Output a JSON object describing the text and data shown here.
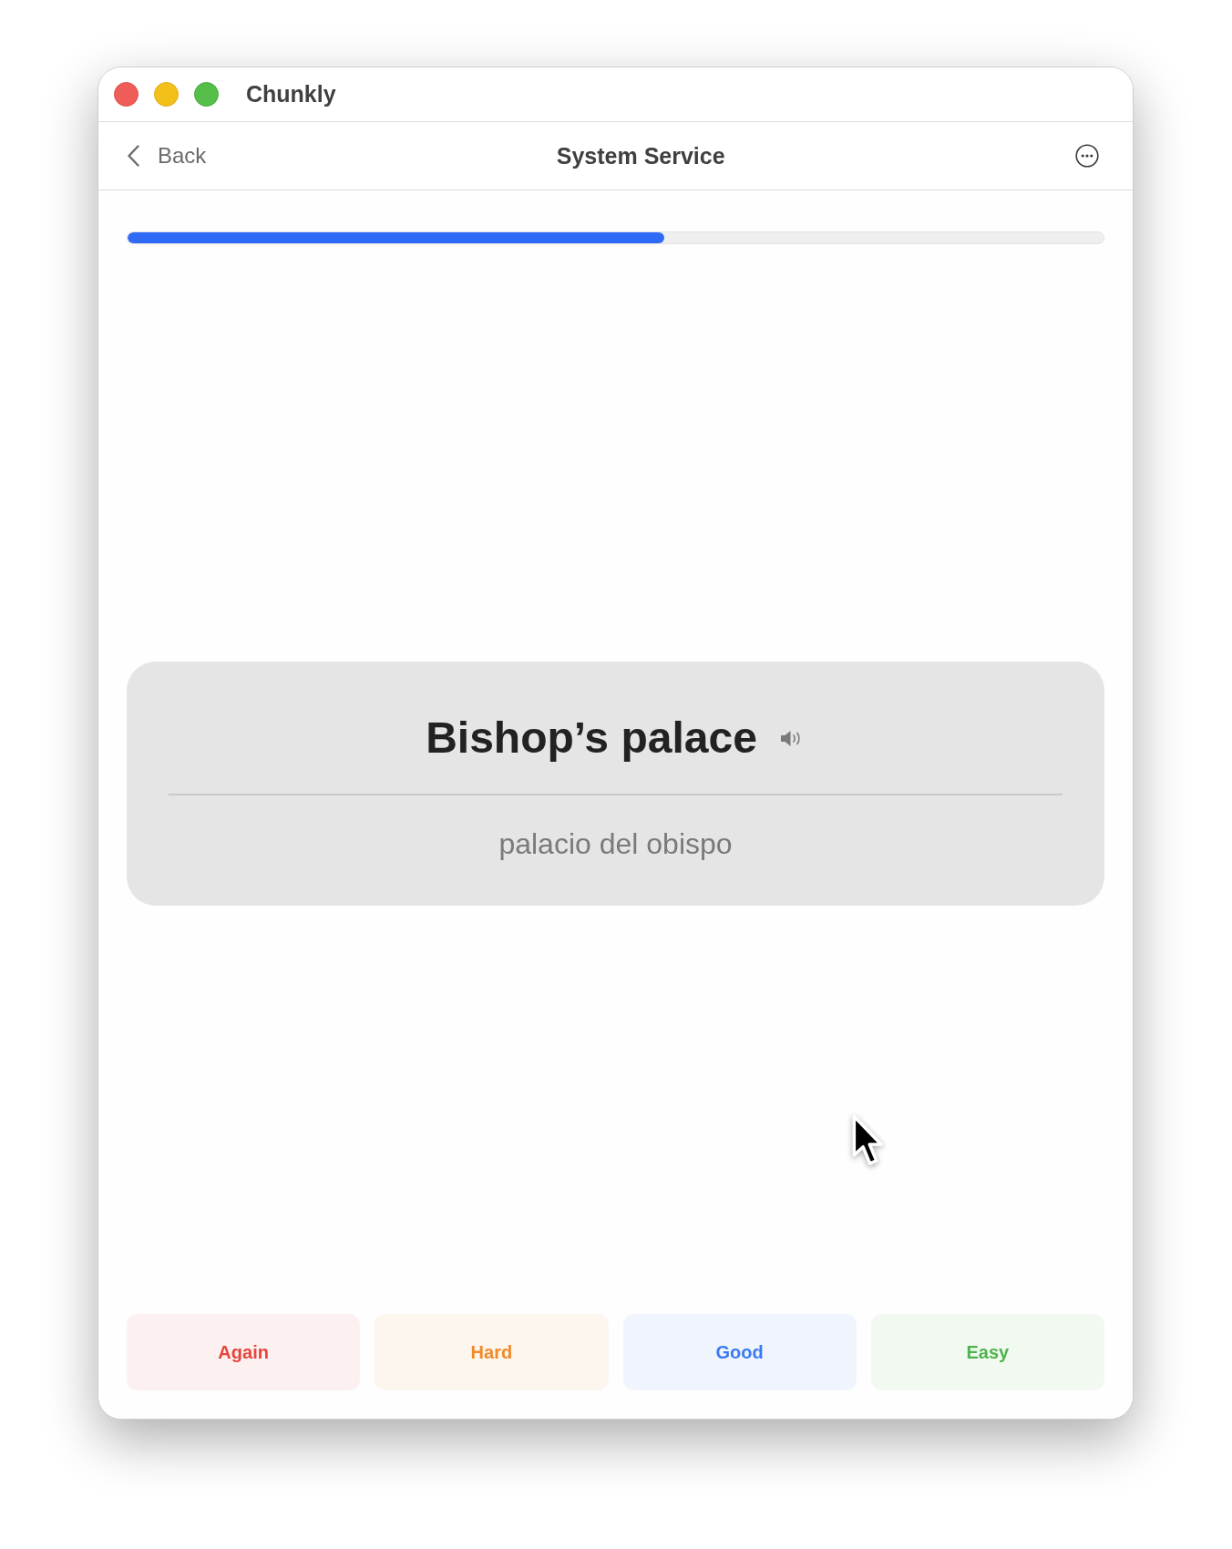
{
  "window": {
    "title": "Chunkly"
  },
  "nav": {
    "back_label": "Back",
    "title": "System Service"
  },
  "progress": {
    "level": 0.55
  },
  "card": {
    "term": "Bishop’s palace",
    "translation": "palacio del obispo"
  },
  "buttons": [
    {
      "label": "Again",
      "color": "#e6443c"
    },
    {
      "label": "Hard",
      "color": "#f08a28"
    },
    {
      "label": "Good",
      "color": "#3a7af2"
    },
    {
      "label": "Easy",
      "color": "#4fb44d"
    }
  ]
}
